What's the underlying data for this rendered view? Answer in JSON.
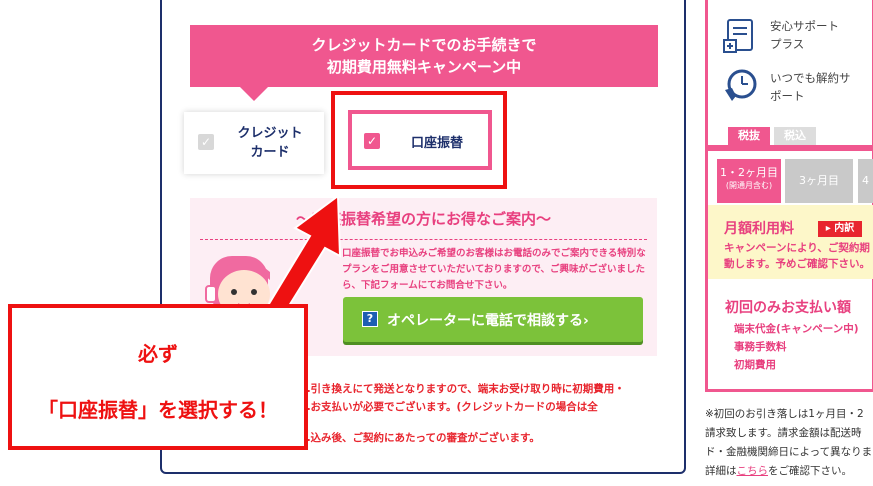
{
  "banner": {
    "line1": "クレジットカードでのお手続きで",
    "line2": "初期費用無料キャンペーン中"
  },
  "payment_options": {
    "credit": {
      "line1": "クレジット",
      "line2": "カード",
      "checked": false
    },
    "bank": {
      "label": "口座振替",
      "checked": true
    }
  },
  "info": {
    "title": "〜口座振替希望の方にお得なご案内〜",
    "text": "口座振替でお申込みご希望のお客様はお電話のみでご案内できる特別なプランをご用意させていただいておりますので、ご興味がございましたら、下記フォームにてお問合せ下さい。",
    "button_label": "オペレーターに電話で相談する",
    "button_chevron": "›"
  },
  "notice": {
    "line1": "…引き換えにて発送となりますので、端末お受け取り時に初期費用・",
    "line2": "…お支払いが必要でございます。(クレジットカードの場合は全",
    "line3": "…込み後、ご契約にあたっての審査がございます。"
  },
  "callout": {
    "line1": "必ず",
    "line2": "「口座振替」を選択する！"
  },
  "sidebar": {
    "features": [
      {
        "line1": "安心サポート",
        "line2": "プラス",
        "icon": "support-plus-icon"
      },
      {
        "line1": "いつでも解約サ",
        "line2": "ポート",
        "icon": "clock-phone-icon"
      }
    ],
    "tax_tabs": [
      "税抜",
      "税込"
    ],
    "month_tabs": [
      {
        "line1": "1・2ヶ月目",
        "line2": "(開通月含む)"
      },
      {
        "line1": "3ヶ月目",
        "line2": ""
      },
      {
        "line1": "4",
        "line2": ""
      }
    ],
    "fee": {
      "title": "月額利用料",
      "badge": "内訳",
      "line1": "キャンペーンにより、ご契約期",
      "line2": "動します。予めご確認下さい。"
    },
    "first_payment": {
      "title": "初回のみお支払い額",
      "items": [
        "端末代金(キャンペーン中)",
        "事務手数料",
        "初期費用"
      ]
    },
    "footnote": {
      "line1": "※初回のお引き落しは1ヶ月目・2",
      "line2": "請求致します。請求金額は配送時",
      "line3": "ド・金融機関締日によって異なりま",
      "line4_pre": "詳細は",
      "line4_link": "こちら",
      "line4_post": "をご確認下さい。"
    }
  },
  "colors": {
    "pink": "#f0578f",
    "navy": "#1d2f6b",
    "red": "#ee1111",
    "green": "#7cc23a"
  }
}
